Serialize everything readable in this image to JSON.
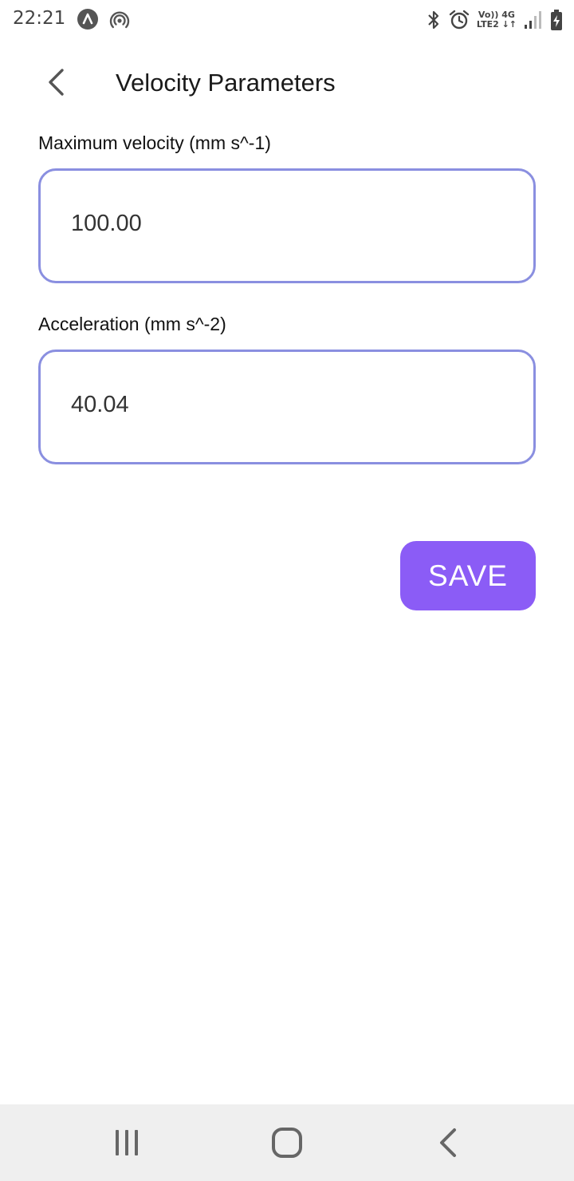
{
  "status_bar": {
    "time": "22:21",
    "network_top": "Vo)) 4G",
    "network_bottom": "LTE2 ↓↑",
    "icons": [
      "autodesk-icon",
      "hotspot-icon",
      "bluetooth-icon",
      "alarm-icon",
      "signal-icon",
      "battery-charging-icon"
    ]
  },
  "app_bar": {
    "title": "Velocity Parameters",
    "back_icon": "chevron-left-icon"
  },
  "form": {
    "max_velocity": {
      "label": "Maximum velocity (mm s^-1)",
      "value": "100.00"
    },
    "acceleration": {
      "label": "Acceleration (mm s^-2)",
      "value": "40.04"
    },
    "save_label": "SAVE"
  },
  "colors": {
    "field_border": "#8a8fe0",
    "save_button": "#8b5cf6",
    "nav_bar_bg": "#efefef"
  },
  "nav_bar": {
    "icons": [
      "recent-apps-icon",
      "home-icon",
      "back-icon"
    ]
  }
}
